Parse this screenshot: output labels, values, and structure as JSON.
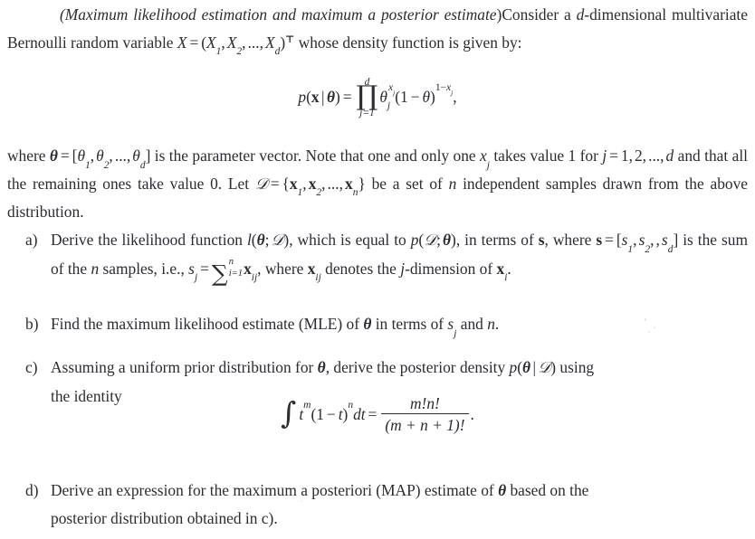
{
  "document": {
    "type": "exercise",
    "background_color": "#ffffff",
    "text_color": "#2b2b33",
    "title_parenthetical": "(Maximum likelihood estimation and maximum a posterior estimate)"
  },
  "intro": {
    "title_italic": "Maximum likelihood estimation and maximum a posterior estimate",
    "text_before_vector": "Consider a d-dimensional multivariate Bernoulli random variable",
    "variable": "X",
    "vector_components": "(X1, X2, ..., Xd)",
    "transpose_mark": "⊤",
    "text_after_vector": "whose density function is given by:",
    "plain": "(Maximum likelihood estimation and maximum a posterior estimate) Consider a d-dimensional multivariate Bernoulli random variable X = (X1, X2, ..., Xd)T whose density function is given by:"
  },
  "density_equation": {
    "lhs": "p(x | θ)",
    "equals": "=",
    "product_operator": "∏",
    "product_upper_limit": "d",
    "product_lower_limit": "j=1",
    "body": "θj^{xj} (1 − θ)^{1−xj}",
    "trailing_punctuation": ",",
    "plain": "p(x|θ) = ∏_{j=1}^{d} θ_j^{x_j} (1-θ)^{1-x_j},"
  },
  "where_paragraph": {
    "plain": "where θ = [θ1, θ2, ..., θd] is the parameter vector. Note that one and only one xj takes value 1 for j = 1, 2, ..., d and that all the remaining ones take value 0. Let D = {x1, x2, ..., xn} be a set of n independent samples drawn from the above distribution.",
    "parameter_vector": "θ = [θ1, θ2, ..., θd]",
    "dataset": "D = {x1, x2, ..., xn}",
    "sample_count": "n"
  },
  "items": [
    {
      "marker": "a)",
      "id": "item-a",
      "plain": "Derive the likelihood function l(θ; D), which is equal to p(D; θ), in terms of s, where s = [s1, s2, , sd] is the sum of the n samples, i.e., sj = ∑_{i=1}^{n} xij, where xij denotes the j-dimension of xi.",
      "likelihood": "l(θ; D)",
      "equal_to": "p(D; θ)",
      "s_vector": "s = [s1, s2, , sd]",
      "s_definition": "sj = ∑_{i=1}^{n} xij"
    },
    {
      "marker": "b)",
      "id": "item-b",
      "plain": "Find the maximum likelihood estimate (MLE) of θ in terms of sj and n.",
      "acronym": "MLE"
    },
    {
      "marker": "c)",
      "id": "item-c",
      "plain": "Assuming a uniform prior distribution for θ, derive the posterior density p(θ | D) using the identity",
      "posterior": "p(θ | D)"
    },
    {
      "marker": "d)",
      "id": "item-d",
      "plain": "Derive an expression for the maximum a posteriori (MAP) estimate of θ based on the posterior distribution obtained in c).",
      "acronym": "MAP"
    }
  ],
  "integral_identity": {
    "integral_sign": "∫",
    "integrand": "t^m (1 − t)^n dt",
    "equals": "=",
    "numerator": "m!n!",
    "denominator": "(m + n + 1)!",
    "trailing_punctuation": ".",
    "plain": "∫ t^m (1-t)^n dt = m!n! / (m+n+1)!."
  },
  "text": {
    "intro_lead_rest": "Consider a ",
    "d_italic": "d",
    "hyphen": "-",
    "intro_line2a": "dimensional multivariate Bernoulli random variable ",
    "intro_line2b": " whose density",
    "intro_line3": "function is given by:",
    "where_lead": "where ",
    "where_mid1": " is the parameter vector. Note that one and only one ",
    "where_mid2": " takes value",
    "where_mid3": "1 for ",
    "where_mid4": " and that all the remaining ones take value 0. Let ",
    "where_mid5": " be",
    "where_last": "a set of ",
    "where_last2": " independent samples drawn from the above distribution.",
    "a_t1": "Derive the likelihood function ",
    "a_t2": ", which is equal to ",
    "a_t3": ", in terms of ",
    "a_t4": ", where",
    "a_t5": " is the sum of the ",
    "a_t6": " samples, i.e., ",
    "a_t7": ", where ",
    "a_t8": " denotes the",
    "a_t9": "-dimension of ",
    "a_t10": ".",
    "b_t1": "Find the maximum likelihood estimate (MLE) of ",
    "b_t2": " in terms of ",
    "b_t3": " and ",
    "b_t4": ".",
    "c_t1": "Assuming a uniform prior distribution for ",
    "c_t2": ", derive the posterior density ",
    "c_t3": " using",
    "c_t4": "the identity",
    "d_t1": "Derive an expression for the maximum a posteriori (MAP) estimate of ",
    "d_t2": " based on the",
    "d_t3": "posterior distribution obtained in c)."
  },
  "symbols": {
    "theta": "θ",
    "theta_bold": "θ",
    "x_bold": "x",
    "s_bold": "s",
    "script_d": "𝒟",
    "product": "∏",
    "sum": "∑",
    "integral": "∫",
    "minus": "−",
    "transpose": "⊤",
    "equals": "=",
    "n": "n",
    "j": "j",
    "d": "d"
  }
}
